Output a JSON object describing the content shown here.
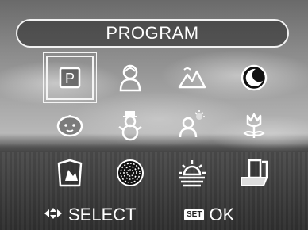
{
  "header": {
    "title": "PROGRAM"
  },
  "modes": [
    {
      "icon": "program-p-icon",
      "label": "P",
      "selected": true
    },
    {
      "icon": "portrait-icon",
      "selected": false
    },
    {
      "icon": "landscape-icon",
      "selected": false
    },
    {
      "icon": "night-icon",
      "selected": false
    },
    {
      "icon": "baby-icon",
      "selected": false
    },
    {
      "icon": "snow-icon",
      "selected": false
    },
    {
      "icon": "backlight-portrait-icon",
      "selected": false
    },
    {
      "icon": "flower-icon",
      "selected": false
    },
    {
      "icon": "museum-icon",
      "selected": false
    },
    {
      "icon": "firework-icon",
      "selected": false
    },
    {
      "icon": "sunset-icon",
      "selected": false
    },
    {
      "icon": "text-document-icon",
      "selected": false
    }
  ],
  "footer": {
    "select_icon": "four-way-arrow-icon",
    "select_label": "SELECT",
    "set_badge": "SET",
    "ok_label": "OK"
  }
}
